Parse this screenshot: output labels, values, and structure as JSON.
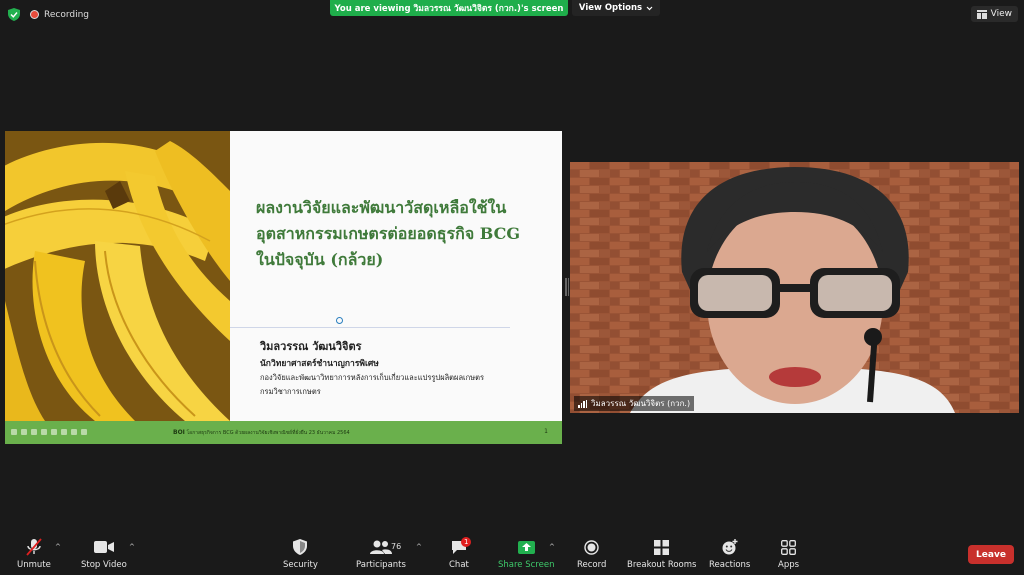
{
  "top": {
    "recording_label": "Recording",
    "viewing_banner": "You are viewing วิมลวรรณ วัฒนวิจิตร (กวก.)'s screen",
    "view_options": "View Options",
    "view_label": "View"
  },
  "slide": {
    "title_lines": [
      "ผลงานวิจัยและพัฒนาวัสดุเหลือใช้ใน",
      "อุตสาหกรรมเกษตรต่อยอดธุรกิจ BCG",
      "ในปัจจุบัน (กล้วย)"
    ],
    "author": "วิมลวรรณ วัฒนวิจิตร",
    "position": "นักวิทยาศาสตร์ชำนาญการพิเศษ",
    "division": "กองวิจัยและพัฒนาวิทยาการหลังการเก็บเกี่ยวและแปรรูปผลิตผลเกษตร",
    "department": "กรมวิชาการเกษตร",
    "footer_bold": "BOI",
    "footer_text": "โอกาสธุรกิจการ BCG ด้วยผลงานวิจัยเชิงพาณิชย์ที่ยั่งยืน 23 ธันวาคม 2564",
    "footer_bcg": "BCG",
    "slide_number": "1"
  },
  "video": {
    "participant_name": "วิมลวรรณ วัฒนวิจิตร (กวก.)"
  },
  "toolbar": {
    "unmute": "Unmute",
    "stop_video": "Stop Video",
    "security": "Security",
    "participants": "Participants",
    "participants_count": "76",
    "chat": "Chat",
    "chat_badge": "1",
    "share_screen": "Share Screen",
    "record": "Record",
    "breakout_rooms": "Breakout Rooms",
    "reactions": "Reactions",
    "apps": "Apps",
    "leave": "Leave"
  },
  "colors": {
    "banner_green": "#1fae4b",
    "leave_red": "#c8302c",
    "slide_title_green": "#3f7a3a",
    "footer_green": "#6ab04c"
  },
  "icons": [
    "shield-icon",
    "recording-icon",
    "chevron-down-icon",
    "view-grid-icon",
    "mic-muted-icon",
    "camera-icon",
    "security-shield-icon",
    "participants-icon",
    "chat-icon",
    "share-screen-icon",
    "record-icon",
    "breakout-rooms-icon",
    "reactions-icon",
    "apps-icon"
  ]
}
